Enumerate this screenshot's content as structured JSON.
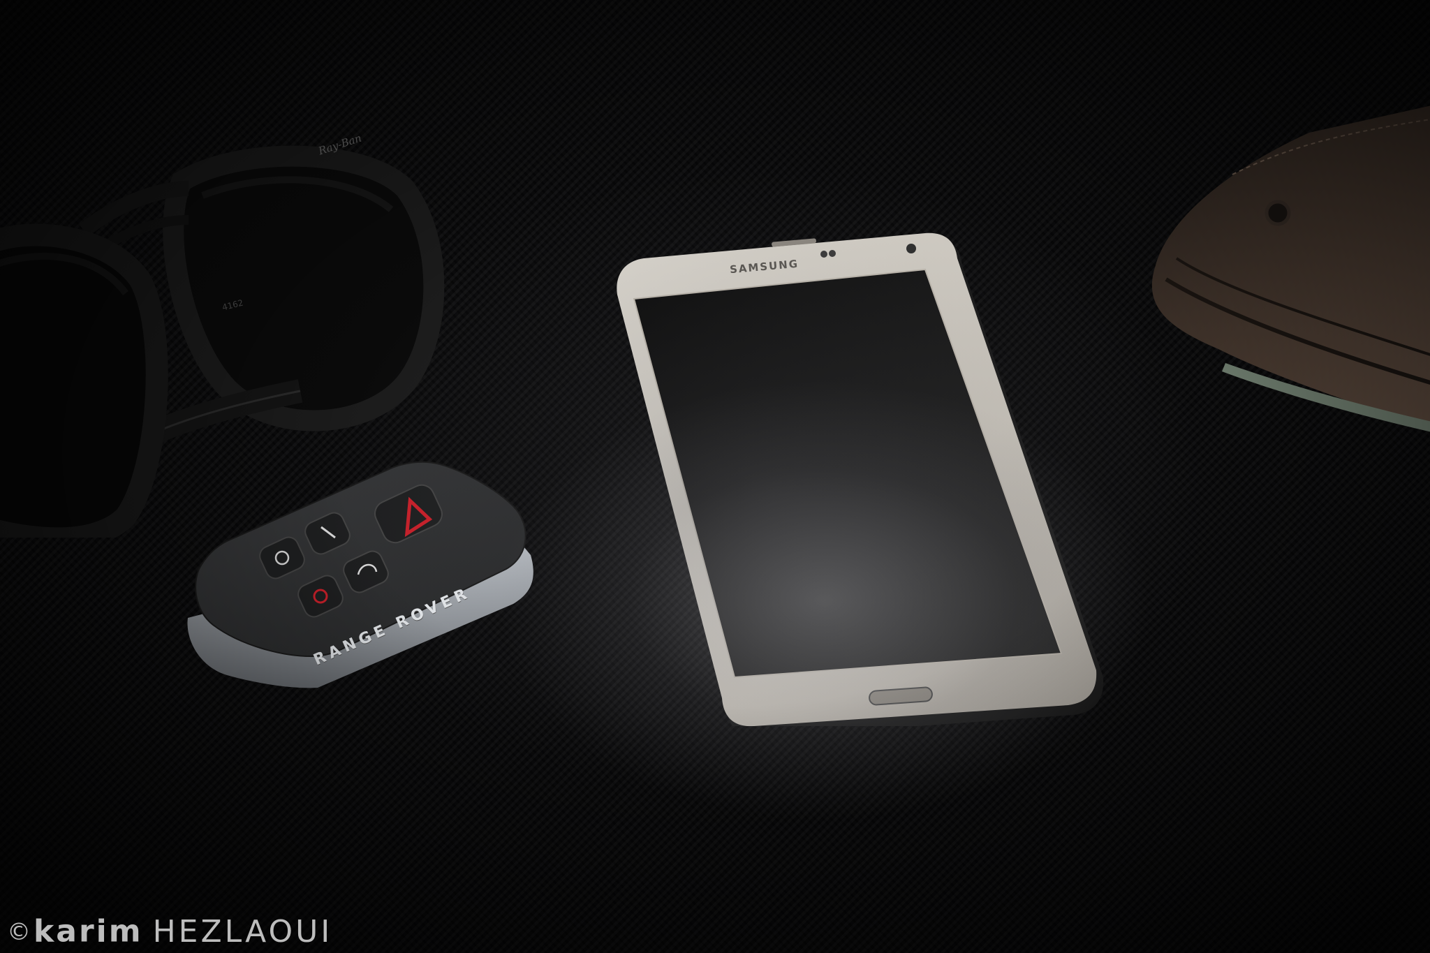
{
  "photo": {
    "background": "carbon-fiber surface, dark, spotlit",
    "colors": {
      "surface": "#0b0b0c",
      "phone_body": "#cfcac2",
      "phone_screen": "#141414",
      "key_fob": "#2f3032",
      "key_fob_accent": "#c8202a",
      "key_fob_band": "#9da2a8",
      "wallet": "#3b2f28",
      "sunglasses": "#0d0d0d"
    },
    "items": {
      "sunglasses": {
        "brand_text": "Ray-Ban",
        "model_text": "4162"
      },
      "phone": {
        "brand_text": "SAMSUNG"
      },
      "key_fob": {
        "brand_text": "RANGE ROVER"
      },
      "wallet": {}
    }
  },
  "watermark": {
    "symbol": "©",
    "first_name": "karim",
    "last_name": "HEZLAOUI"
  }
}
